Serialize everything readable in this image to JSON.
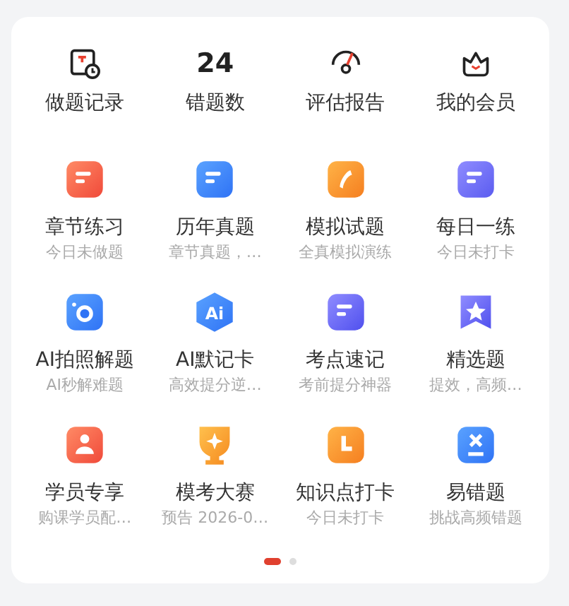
{
  "stats": [
    {
      "kind": "icon",
      "label": "做题记录"
    },
    {
      "kind": "count",
      "value": "24",
      "label": "错题数"
    },
    {
      "kind": "icon",
      "label": "评估报告"
    },
    {
      "kind": "icon",
      "label": "我的会员"
    }
  ],
  "tools": [
    {
      "title": "章节练习",
      "subtitle": "今日未做题"
    },
    {
      "title": "历年真题",
      "subtitle": "章节真题，…"
    },
    {
      "title": "模拟试题",
      "subtitle": "全真模拟演练"
    },
    {
      "title": "每日一练",
      "subtitle": "今日未打卡"
    },
    {
      "title": "AI拍照解题",
      "subtitle": "AI秒解难题"
    },
    {
      "title": "AI默记卡",
      "subtitle": "高效提分逆…",
      "icon_text": "Ai"
    },
    {
      "title": "考点速记",
      "subtitle": "考前提分神器"
    },
    {
      "title": "精选题",
      "subtitle": "提效，高频…"
    },
    {
      "title": "学员专享",
      "subtitle": "购课学员配…"
    },
    {
      "title": "模考大赛",
      "subtitle": "预告 2026-0…"
    },
    {
      "title": "知识点打卡",
      "subtitle": "今日未打卡"
    },
    {
      "title": "易错题",
      "subtitle": "挑战高频错题"
    }
  ],
  "pager": [
    {
      "selected": true
    },
    {
      "selected": false
    }
  ]
}
